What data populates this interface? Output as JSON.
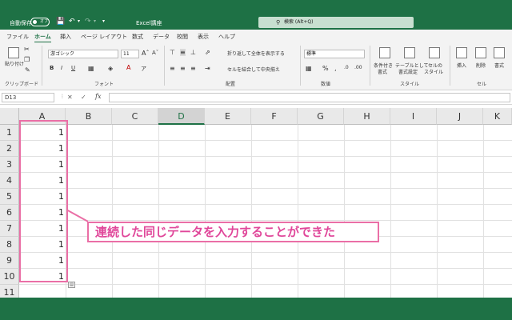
{
  "titlebar": {
    "autosave_label": "自動保存",
    "autosave_state": "オフ",
    "doc_title": "Excel講座",
    "search_placeholder": "検索 (Alt+Q)"
  },
  "tabs": [
    "ファイル",
    "ホーム",
    "挿入",
    "ページ レイアウト",
    "数式",
    "データ",
    "校閲",
    "表示",
    "ヘルプ"
  ],
  "active_tab": "ホーム",
  "ribbon": {
    "paste_label": "貼り付け",
    "clipboard_label": "クリップボード",
    "font_name": "游ゴシック",
    "font_size": "11",
    "font_group_label": "フォント",
    "wrap_label": "折り返して全体を表示する",
    "merge_label": "セルを結合して中央揃え",
    "alignment_label": "配置",
    "number_format": "標準",
    "number_label": "数値",
    "cond_format_1": "条件付き",
    "cond_format_2": "書式",
    "table_format_1": "テーブルとして",
    "table_format_2": "書式設定",
    "cell_style_1": "セルの",
    "cell_style_2": "スタイル",
    "styles_label": "スタイル",
    "insert_label": "挿入",
    "delete_label": "削除",
    "format_label": "書式",
    "cells_label": "セル"
  },
  "formula_bar": {
    "name_box": "D13",
    "fx": "fx",
    "formula": ""
  },
  "grid": {
    "columns": [
      "A",
      "B",
      "C",
      "D",
      "E",
      "F",
      "G",
      "H",
      "I",
      "J",
      "K"
    ],
    "selected_column": "D",
    "rows": [
      "1",
      "2",
      "3",
      "4",
      "5",
      "6",
      "7",
      "8",
      "9",
      "10",
      "11"
    ],
    "col_a_values": [
      "1",
      "1",
      "1",
      "1",
      "1",
      "1",
      "1",
      "1",
      "1",
      "1"
    ]
  },
  "annotation": {
    "text": "連続した同じデータを入力することができた"
  },
  "colors": {
    "excel_green": "#1e7145",
    "highlight_pink": "#ea6fa6",
    "callout_text": "#e0479a"
  }
}
